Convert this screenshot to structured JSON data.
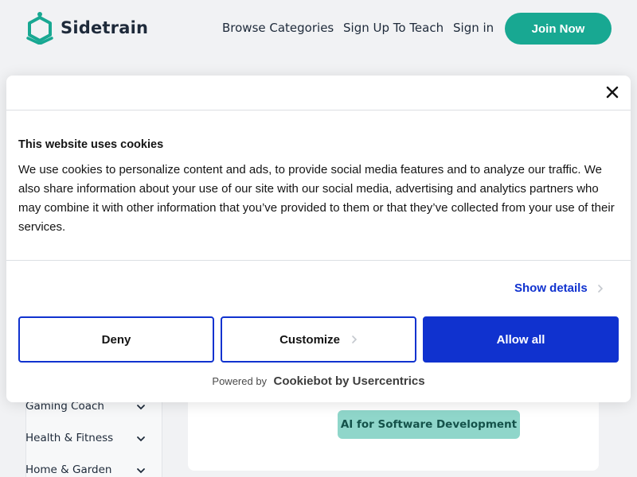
{
  "header": {
    "brand": "Sidetrain",
    "nav": {
      "browse": "Browse Categories",
      "teach": "Sign Up To Teach",
      "signin": "Sign in"
    },
    "join_label": "Join Now",
    "logo_icon": "hexagon-shield-logo-icon",
    "brand_color": "#18a892"
  },
  "background": {
    "categories": [
      {
        "label": "Gaming Coach",
        "icon": "chevron-down-icon"
      },
      {
        "label": "Health & Fitness",
        "icon": "chevron-down-icon"
      },
      {
        "label": "Home & Garden",
        "icon": "chevron-down-icon"
      }
    ],
    "pill_label": "AI for Software Development"
  },
  "cookie_dialog": {
    "title": "This website uses cookies",
    "body": "We use cookies to personalize content and ads, to provide social media features and to analyze our traffic. We also share information about your use of our site with our social media, advertising and analytics partners who may combine it with other information that you’ve provided to them or that they’ve collected from your use of their services.",
    "show_details": "Show details",
    "buttons": {
      "deny": "Deny",
      "customize": "Customize",
      "allow": "Allow all"
    },
    "powered_by": "Powered by",
    "powered_brand": "Cookiebot by Usercentrics",
    "accent_color": "#1032cf",
    "close_icon": "close-icon"
  }
}
